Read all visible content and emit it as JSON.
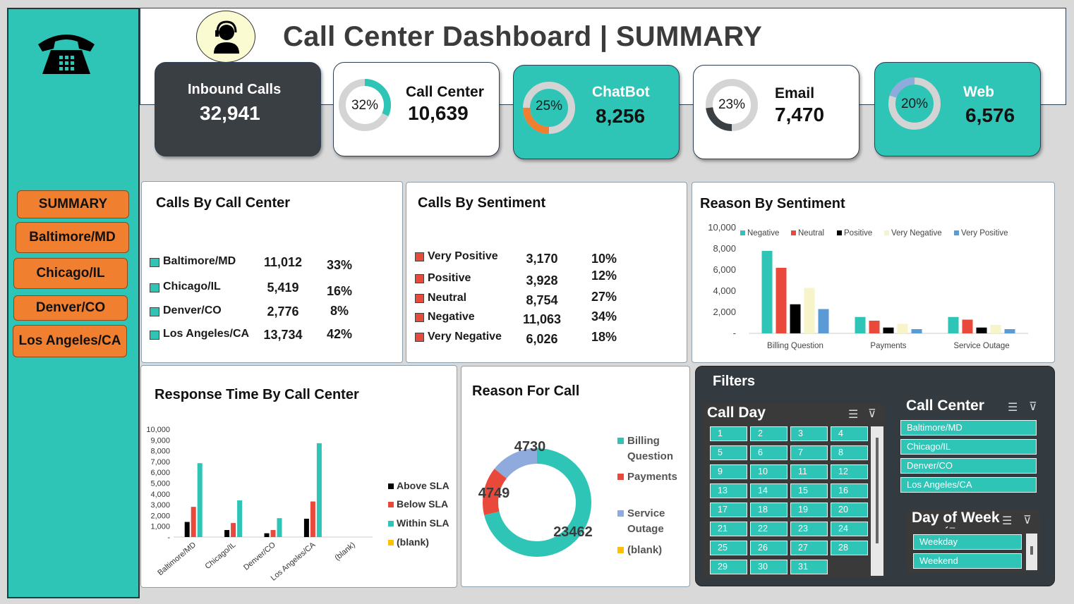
{
  "title": "Call Center Dashboard | SUMMARY",
  "nav": [
    "SUMMARY",
    "Baltimore/MD",
    "Chicago/IL",
    "Denver/CO",
    "Los Angeles/CA"
  ],
  "kpis": {
    "inbound": {
      "label": "Inbound Calls",
      "value": "32,941"
    },
    "callcenter": {
      "label": "Call Center",
      "value": "10,639",
      "pct": "32%",
      "frac": 0.32
    },
    "chatbot": {
      "label": "ChatBot",
      "value": "8,256",
      "pct": "25%",
      "frac": 0.25
    },
    "email": {
      "label": "Email",
      "value": "7,470",
      "pct": "23%",
      "frac": 0.23
    },
    "web": {
      "label": "Web",
      "value": "6,576",
      "pct": "20%",
      "frac": 0.2
    }
  },
  "colors": {
    "teal": "#2ec4b6",
    "orange": "#f07f2f",
    "dark": "#3a3f44",
    "red": "#e8493a",
    "black": "#000000",
    "cream": "#f6f4c8",
    "blue": "#5b9bd5",
    "lightblue": "#8faadc",
    "yellow": "#ffc000"
  },
  "calls_by_center": {
    "title": "Calls By Call Center",
    "rows": [
      {
        "name": "Baltimore/MD",
        "count": "11,012",
        "pct": "33%"
      },
      {
        "name": "Chicago/IL",
        "count": "5,419",
        "pct": "16%"
      },
      {
        "name": "Denver/CO",
        "count": "2,776",
        "pct": "8%"
      },
      {
        "name": "Los Angeles/CA",
        "count": "13,734",
        "pct": "42%"
      }
    ]
  },
  "calls_by_sentiment": {
    "title": "Calls By Sentiment",
    "rows": [
      {
        "name": "Very Positive",
        "count": "3,170",
        "pct": "10%"
      },
      {
        "name": "Positive",
        "count": "3,928",
        "pct": "12%"
      },
      {
        "name": "Neutral",
        "count": "8,754",
        "pct": "27%"
      },
      {
        "name": "Negative",
        "count": "11,063",
        "pct": "34%"
      },
      {
        "name": "Very Negative",
        "count": "6,026",
        "pct": "18%"
      }
    ]
  },
  "reason_by_sentiment": {
    "title": "Reason By Sentiment",
    "yticks": [
      "10,000",
      "8,000",
      "6,000",
      "4,000",
      "2,000",
      "-"
    ]
  },
  "response_time": {
    "title": "Response Time By Call Center",
    "yticks": [
      "10,000",
      "9,000",
      "8,000",
      "7,000",
      "6,000",
      "5,000",
      "4,000",
      "3,000",
      "2,000",
      "1,000",
      "-"
    ],
    "legend": [
      "Above SLA",
      "Below SLA",
      "Within SLA",
      "(blank)"
    ]
  },
  "reason_for_call": {
    "title": "Reason For Call",
    "labels": [
      "4730",
      "4749",
      "23462"
    ],
    "legend": [
      [
        "Billing",
        "Question"
      ],
      [
        "Payments"
      ],
      [
        "Service",
        "Outage"
      ],
      [
        "(blank)"
      ]
    ]
  },
  "filters": {
    "title": "Filters",
    "call_day_title": "Call Day",
    "days": [
      "1",
      "2",
      "3",
      "4",
      "5",
      "6",
      "7",
      "8",
      "9",
      "10",
      "11",
      "12",
      "13",
      "14",
      "15",
      "16",
      "17",
      "18",
      "19",
      "20",
      "21",
      "22",
      "23",
      "24",
      "25",
      "26",
      "27",
      "28",
      "29",
      "30",
      "31"
    ],
    "call_center_title": "Call Center",
    "centers": [
      "Baltimore/MD",
      "Chicago/IL",
      "Denver/CO",
      "Los Angeles/CA"
    ],
    "dow_title": "Day of Week",
    "dow_hidden": "Weekday_End",
    "dows": [
      "Weekday",
      "Weekend"
    ]
  },
  "chart_data": [
    {
      "type": "bar",
      "title": "Reason By Sentiment",
      "categories": [
        "Billing Question",
        "Payments",
        "Service Outage"
      ],
      "ylim": [
        0,
        10000
      ],
      "legend": "top",
      "series": [
        {
          "name": "Negative",
          "values": [
            7800,
            1550,
            1550
          ]
        },
        {
          "name": "Neutral",
          "values": [
            6200,
            1200,
            1300
          ]
        },
        {
          "name": "Positive",
          "values": [
            2750,
            550,
            550
          ]
        },
        {
          "name": "Very Negative",
          "values": [
            4300,
            900,
            800
          ]
        },
        {
          "name": "Very Positive",
          "values": [
            2300,
            400,
            400
          ]
        }
      ]
    },
    {
      "type": "bar",
      "title": "Response Time By Call Center",
      "categories": [
        "Baltimore/MD",
        "Chicago/IL",
        "Denver/CO",
        "Los Angeles/CA",
        "(blank)"
      ],
      "ylim": [
        0,
        10000
      ],
      "legend": "right",
      "series": [
        {
          "name": "Above SLA",
          "values": [
            1400,
            650,
            350,
            1700,
            0
          ]
        },
        {
          "name": "Below SLA",
          "values": [
            2800,
            1300,
            650,
            3300,
            0
          ]
        },
        {
          "name": "Within SLA",
          "values": [
            6850,
            3400,
            1750,
            8700,
            0
          ]
        },
        {
          "name": "(blank)",
          "values": [
            0,
            0,
            0,
            0,
            0
          ]
        }
      ]
    },
    {
      "type": "pie",
      "title": "Reason For Call",
      "categories": [
        "Billing Question",
        "Payments",
        "Service Outage",
        "(blank)"
      ],
      "values": [
        23462,
        4749,
        4730,
        0
      ]
    }
  ]
}
